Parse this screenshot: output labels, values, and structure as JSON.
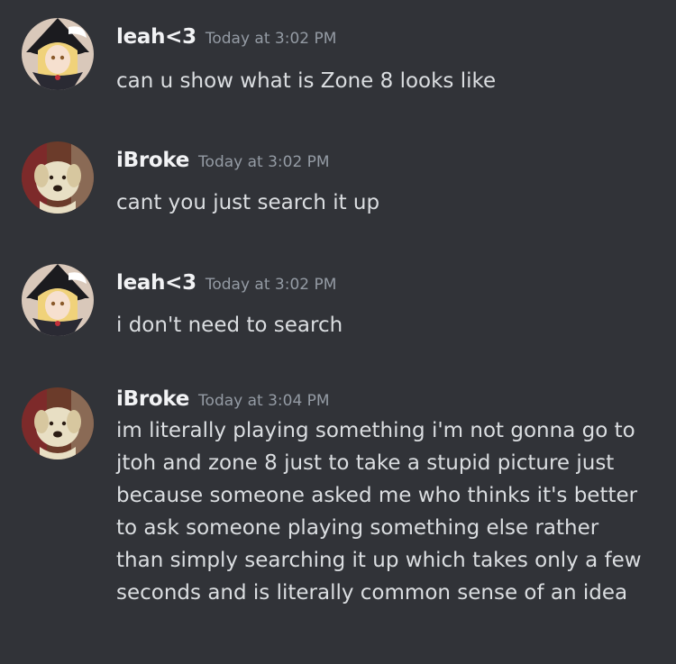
{
  "messages": [
    {
      "author": "leah<3",
      "avatar": "anime-girl-avatar",
      "time": "Today at 3:02 PM",
      "text": "can u show what is Zone 8 looks like"
    },
    {
      "author": "iBroke",
      "avatar": "dog-avatar",
      "time": "Today at 3:02 PM",
      "text": "cant you just search it up"
    },
    {
      "author": "leah<3",
      "avatar": "anime-girl-avatar",
      "time": "Today at 3:02 PM",
      "text": "i don't need to search"
    },
    {
      "author": "iBroke",
      "avatar": "dog-avatar",
      "time": "Today at 3:04 PM",
      "lines": [
        "im literally playing something i'm not gonna go to",
        "jtoh and zone 8 just to take a stupid picture just",
        "because someone asked me who thinks it's better",
        "to ask someone playing something else rather",
        "than simply searching it up which takes only a few",
        "seconds and is literally common sense of an idea"
      ]
    }
  ],
  "colors": {
    "background": "#313338",
    "username": "#f2f3f5",
    "timestamp": "#949ba4",
    "text": "#dbdee1"
  }
}
